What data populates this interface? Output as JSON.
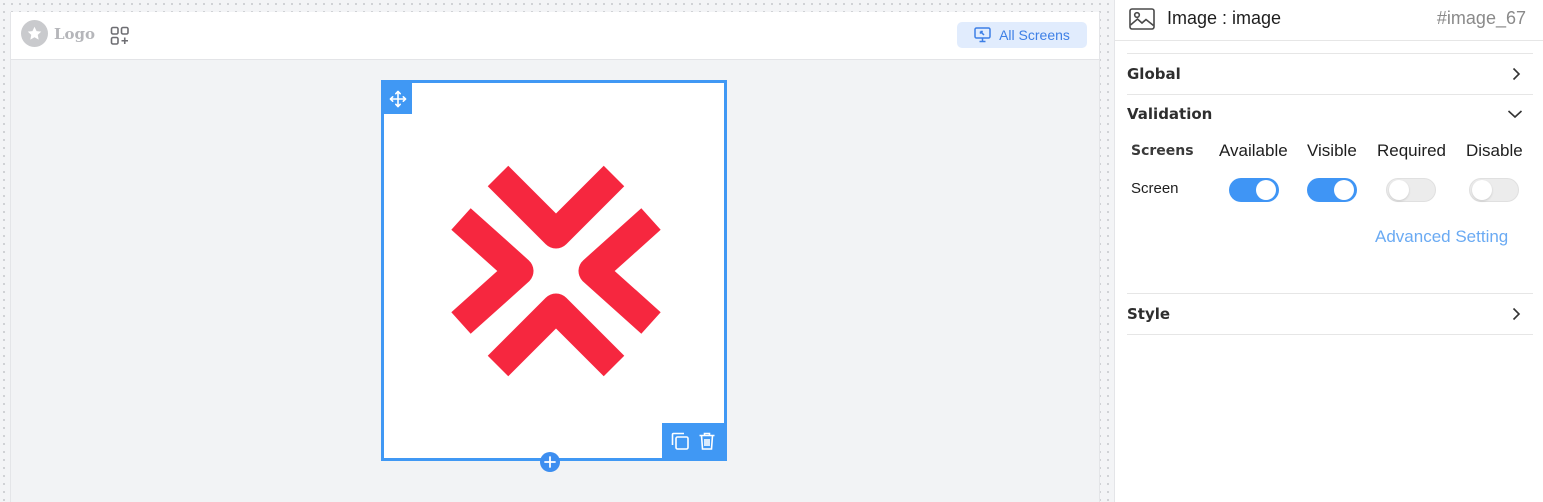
{
  "app": {
    "logo_label": "Logo",
    "all_screens_label": "All Screens",
    "brand_color": "#4098f4"
  },
  "canvas": {
    "selected_element": {
      "type": "image",
      "mark_color": "#f6273f",
      "icons": [
        "move-icon",
        "duplicate-icon",
        "trash-icon",
        "add-icon"
      ]
    }
  },
  "panel": {
    "title": "Image : image",
    "element_id": "#image_67",
    "sections": {
      "global": {
        "label": "Global",
        "expanded": false
      },
      "validation": {
        "label": "Validation",
        "expanded": true
      },
      "style": {
        "label": "Style",
        "expanded": false
      }
    },
    "validation": {
      "columns": {
        "screens": "Screens",
        "available": "Available",
        "visible": "Visible",
        "required": "Required",
        "disable": "Disable"
      },
      "rows": [
        {
          "label": "Screen",
          "available": true,
          "visible": true,
          "required": false,
          "disable": false
        }
      ],
      "advanced_link": "Advanced Setting"
    }
  }
}
